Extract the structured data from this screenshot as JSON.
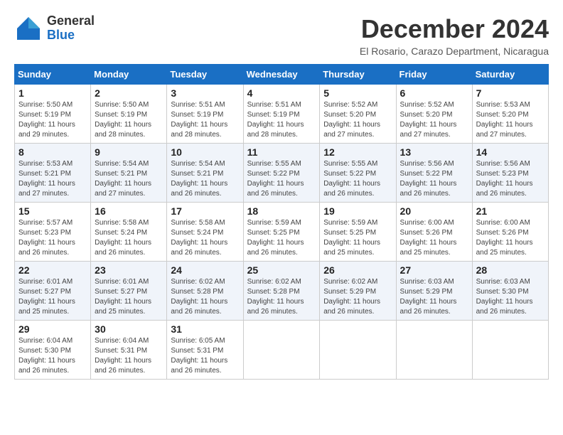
{
  "logo": {
    "general": "General",
    "blue": "Blue"
  },
  "title": "December 2024",
  "location": "El Rosario, Carazo Department, Nicaragua",
  "days_of_week": [
    "Sunday",
    "Monday",
    "Tuesday",
    "Wednesday",
    "Thursday",
    "Friday",
    "Saturday"
  ],
  "weeks": [
    [
      {
        "day": "1",
        "detail": "Sunrise: 5:50 AM\nSunset: 5:19 PM\nDaylight: 11 hours\nand 29 minutes."
      },
      {
        "day": "2",
        "detail": "Sunrise: 5:50 AM\nSunset: 5:19 PM\nDaylight: 11 hours\nand 28 minutes."
      },
      {
        "day": "3",
        "detail": "Sunrise: 5:51 AM\nSunset: 5:19 PM\nDaylight: 11 hours\nand 28 minutes."
      },
      {
        "day": "4",
        "detail": "Sunrise: 5:51 AM\nSunset: 5:19 PM\nDaylight: 11 hours\nand 28 minutes."
      },
      {
        "day": "5",
        "detail": "Sunrise: 5:52 AM\nSunset: 5:20 PM\nDaylight: 11 hours\nand 27 minutes."
      },
      {
        "day": "6",
        "detail": "Sunrise: 5:52 AM\nSunset: 5:20 PM\nDaylight: 11 hours\nand 27 minutes."
      },
      {
        "day": "7",
        "detail": "Sunrise: 5:53 AM\nSunset: 5:20 PM\nDaylight: 11 hours\nand 27 minutes."
      }
    ],
    [
      {
        "day": "8",
        "detail": "Sunrise: 5:53 AM\nSunset: 5:21 PM\nDaylight: 11 hours\nand 27 minutes."
      },
      {
        "day": "9",
        "detail": "Sunrise: 5:54 AM\nSunset: 5:21 PM\nDaylight: 11 hours\nand 27 minutes."
      },
      {
        "day": "10",
        "detail": "Sunrise: 5:54 AM\nSunset: 5:21 PM\nDaylight: 11 hours\nand 26 minutes."
      },
      {
        "day": "11",
        "detail": "Sunrise: 5:55 AM\nSunset: 5:22 PM\nDaylight: 11 hours\nand 26 minutes."
      },
      {
        "day": "12",
        "detail": "Sunrise: 5:55 AM\nSunset: 5:22 PM\nDaylight: 11 hours\nand 26 minutes."
      },
      {
        "day": "13",
        "detail": "Sunrise: 5:56 AM\nSunset: 5:22 PM\nDaylight: 11 hours\nand 26 minutes."
      },
      {
        "day": "14",
        "detail": "Sunrise: 5:56 AM\nSunset: 5:23 PM\nDaylight: 11 hours\nand 26 minutes."
      }
    ],
    [
      {
        "day": "15",
        "detail": "Sunrise: 5:57 AM\nSunset: 5:23 PM\nDaylight: 11 hours\nand 26 minutes."
      },
      {
        "day": "16",
        "detail": "Sunrise: 5:58 AM\nSunset: 5:24 PM\nDaylight: 11 hours\nand 26 minutes."
      },
      {
        "day": "17",
        "detail": "Sunrise: 5:58 AM\nSunset: 5:24 PM\nDaylight: 11 hours\nand 26 minutes."
      },
      {
        "day": "18",
        "detail": "Sunrise: 5:59 AM\nSunset: 5:25 PM\nDaylight: 11 hours\nand 26 minutes."
      },
      {
        "day": "19",
        "detail": "Sunrise: 5:59 AM\nSunset: 5:25 PM\nDaylight: 11 hours\nand 25 minutes."
      },
      {
        "day": "20",
        "detail": "Sunrise: 6:00 AM\nSunset: 5:26 PM\nDaylight: 11 hours\nand 25 minutes."
      },
      {
        "day": "21",
        "detail": "Sunrise: 6:00 AM\nSunset: 5:26 PM\nDaylight: 11 hours\nand 25 minutes."
      }
    ],
    [
      {
        "day": "22",
        "detail": "Sunrise: 6:01 AM\nSunset: 5:27 PM\nDaylight: 11 hours\nand 25 minutes."
      },
      {
        "day": "23",
        "detail": "Sunrise: 6:01 AM\nSunset: 5:27 PM\nDaylight: 11 hours\nand 25 minutes."
      },
      {
        "day": "24",
        "detail": "Sunrise: 6:02 AM\nSunset: 5:28 PM\nDaylight: 11 hours\nand 26 minutes."
      },
      {
        "day": "25",
        "detail": "Sunrise: 6:02 AM\nSunset: 5:28 PM\nDaylight: 11 hours\nand 26 minutes."
      },
      {
        "day": "26",
        "detail": "Sunrise: 6:02 AM\nSunset: 5:29 PM\nDaylight: 11 hours\nand 26 minutes."
      },
      {
        "day": "27",
        "detail": "Sunrise: 6:03 AM\nSunset: 5:29 PM\nDaylight: 11 hours\nand 26 minutes."
      },
      {
        "day": "28",
        "detail": "Sunrise: 6:03 AM\nSunset: 5:30 PM\nDaylight: 11 hours\nand 26 minutes."
      }
    ],
    [
      {
        "day": "29",
        "detail": "Sunrise: 6:04 AM\nSunset: 5:30 PM\nDaylight: 11 hours\nand 26 minutes."
      },
      {
        "day": "30",
        "detail": "Sunrise: 6:04 AM\nSunset: 5:31 PM\nDaylight: 11 hours\nand 26 minutes."
      },
      {
        "day": "31",
        "detail": "Sunrise: 6:05 AM\nSunset: 5:31 PM\nDaylight: 11 hours\nand 26 minutes."
      },
      {
        "day": "",
        "detail": ""
      },
      {
        "day": "",
        "detail": ""
      },
      {
        "day": "",
        "detail": ""
      },
      {
        "day": "",
        "detail": ""
      }
    ]
  ]
}
